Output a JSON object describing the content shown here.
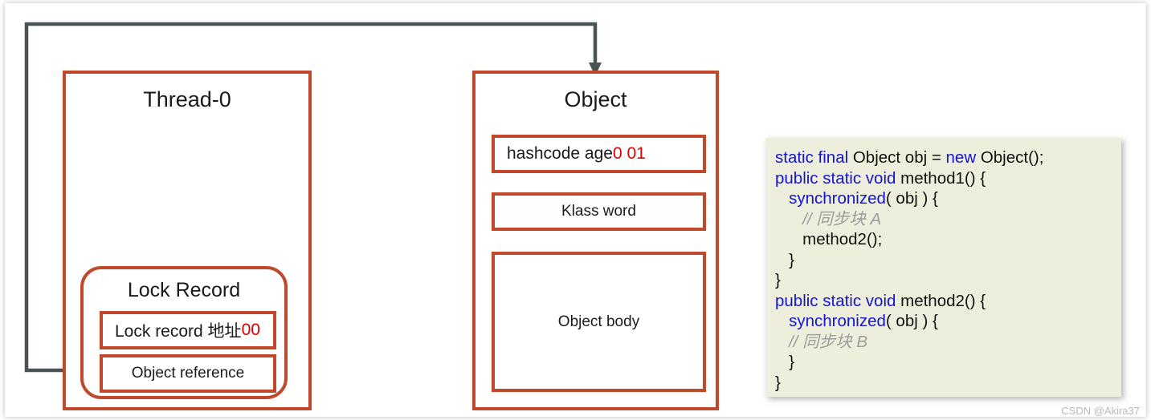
{
  "diagram": {
    "thread_panel": {
      "title": "Thread-0",
      "lock_record": {
        "title": "Lock Record",
        "rows": [
          {
            "label": "Lock record 地址 ",
            "value": "00",
            "value_color": "#E00000"
          },
          {
            "label": "Object reference",
            "value": "",
            "value_color": ""
          }
        ]
      }
    },
    "object_panel": {
      "title": "Object",
      "rows": [
        {
          "label": "hashcode age ",
          "value": "0 01",
          "value_color": "#E00000"
        },
        {
          "label": "Klass word",
          "value": "",
          "value_color": ""
        },
        {
          "label": "Object body",
          "value": "",
          "value_color": ""
        }
      ]
    },
    "connector": {
      "from": "Object reference",
      "to": "Object",
      "color": "#4A5356",
      "arrow": "down-arrow-head"
    },
    "accent_color": "#C0482B"
  },
  "code_panel": {
    "background": "#EDEFDC",
    "keyword_color": "#1414D2",
    "comment_color": "#9C9C9C",
    "lines": [
      [
        {
          "t": "static final",
          "c": "kw"
        },
        {
          "t": " Object obj = ",
          "c": ""
        },
        {
          "t": "new",
          "c": "kw"
        },
        {
          "t": " Object();",
          "c": ""
        }
      ],
      [
        {
          "t": "public static void",
          "c": "kw"
        },
        {
          "t": " method1() {",
          "c": ""
        }
      ],
      [
        {
          "t": "   ",
          "c": ""
        },
        {
          "t": "synchronized",
          "c": "kw"
        },
        {
          "t": "( obj ) {",
          "c": ""
        }
      ],
      [
        {
          "t": "      ",
          "c": ""
        },
        {
          "t": "// 同步块 A",
          "c": "cmt"
        }
      ],
      [
        {
          "t": "      method2();",
          "c": ""
        }
      ],
      [
        {
          "t": "   }",
          "c": ""
        }
      ],
      [
        {
          "t": "}",
          "c": ""
        }
      ],
      [
        {
          "t": "public static void",
          "c": "kw"
        },
        {
          "t": " method2() {",
          "c": ""
        }
      ],
      [
        {
          "t": "   ",
          "c": ""
        },
        {
          "t": "synchronized",
          "c": "kw"
        },
        {
          "t": "( obj ) {",
          "c": ""
        }
      ],
      [
        {
          "t": "   ",
          "c": ""
        },
        {
          "t": "// 同步块 B",
          "c": "cmt"
        }
      ],
      [
        {
          "t": "   }",
          "c": ""
        }
      ],
      [
        {
          "t": "}",
          "c": ""
        }
      ]
    ]
  },
  "watermark": "CSDN @Akira37"
}
